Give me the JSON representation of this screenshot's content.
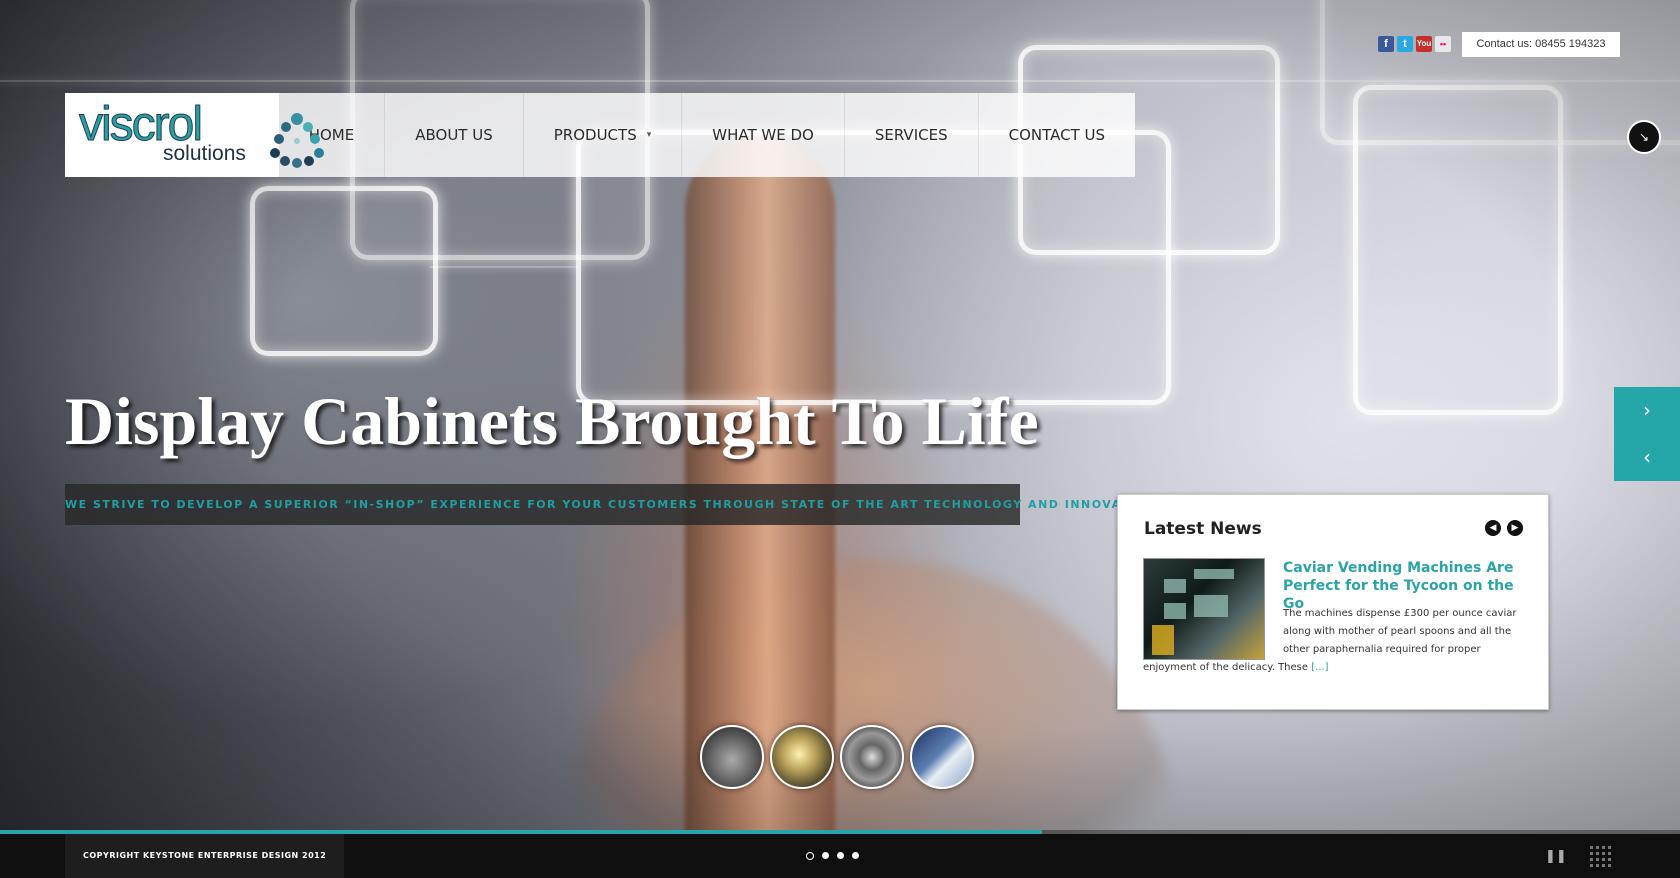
{
  "header": {
    "contact": "Contact us: 08455 194323",
    "social": [
      {
        "name": "facebook-icon",
        "glyph": "f"
      },
      {
        "name": "twitter-icon",
        "glyph": "t"
      },
      {
        "name": "youtube-icon",
        "glyph": "You"
      },
      {
        "name": "flickr-icon",
        "glyph": "••"
      }
    ],
    "logo": {
      "main": "viscrol",
      "sub": "solutions"
    }
  },
  "nav": {
    "items": [
      {
        "label": "HOME"
      },
      {
        "label": "ABOUT US"
      },
      {
        "label": "PRODUCTS",
        "has_dropdown": true
      },
      {
        "label": "WHAT WE DO"
      },
      {
        "label": "SERVICES"
      },
      {
        "label": "CONTACT US"
      }
    ]
  },
  "hero": {
    "title": "Display Cabinets Brought To Life",
    "subtitle": "WE STRIVE TO DEVELOP A SUPERIOR “IN-SHOP” EXPERIENCE FOR YOUR CUSTOMERS THROUGH STATE OF THE ART TECHNOLOGY AND INNOVATION."
  },
  "news": {
    "title": "Latest News",
    "headline": "Caviar Vending Machines Are Perfect for the Tycoon on the Go",
    "body": "The machines dispense £300 per ounce caviar along with mother of pearl spoons and all the other paraphernalia required for proper enjoyment of the delicacy. These",
    "more": "[...]",
    "prev": "◀",
    "next": "▶"
  },
  "slider": {
    "next_arrow": "›",
    "prev_arrow": "‹",
    "thumbnail_count": 4,
    "bullet_count": 4,
    "active_bullet": 0,
    "progress": 0.62,
    "pause_glyph": "❚❚",
    "fullscreen_glyph": "↘"
  },
  "footer": {
    "copyright": "COPYRIGHT KEYSTONE ENTERPRISE DESIGN 2012"
  },
  "colors": {
    "accent": "#25a6a8",
    "dark": "#0f0f0f"
  }
}
